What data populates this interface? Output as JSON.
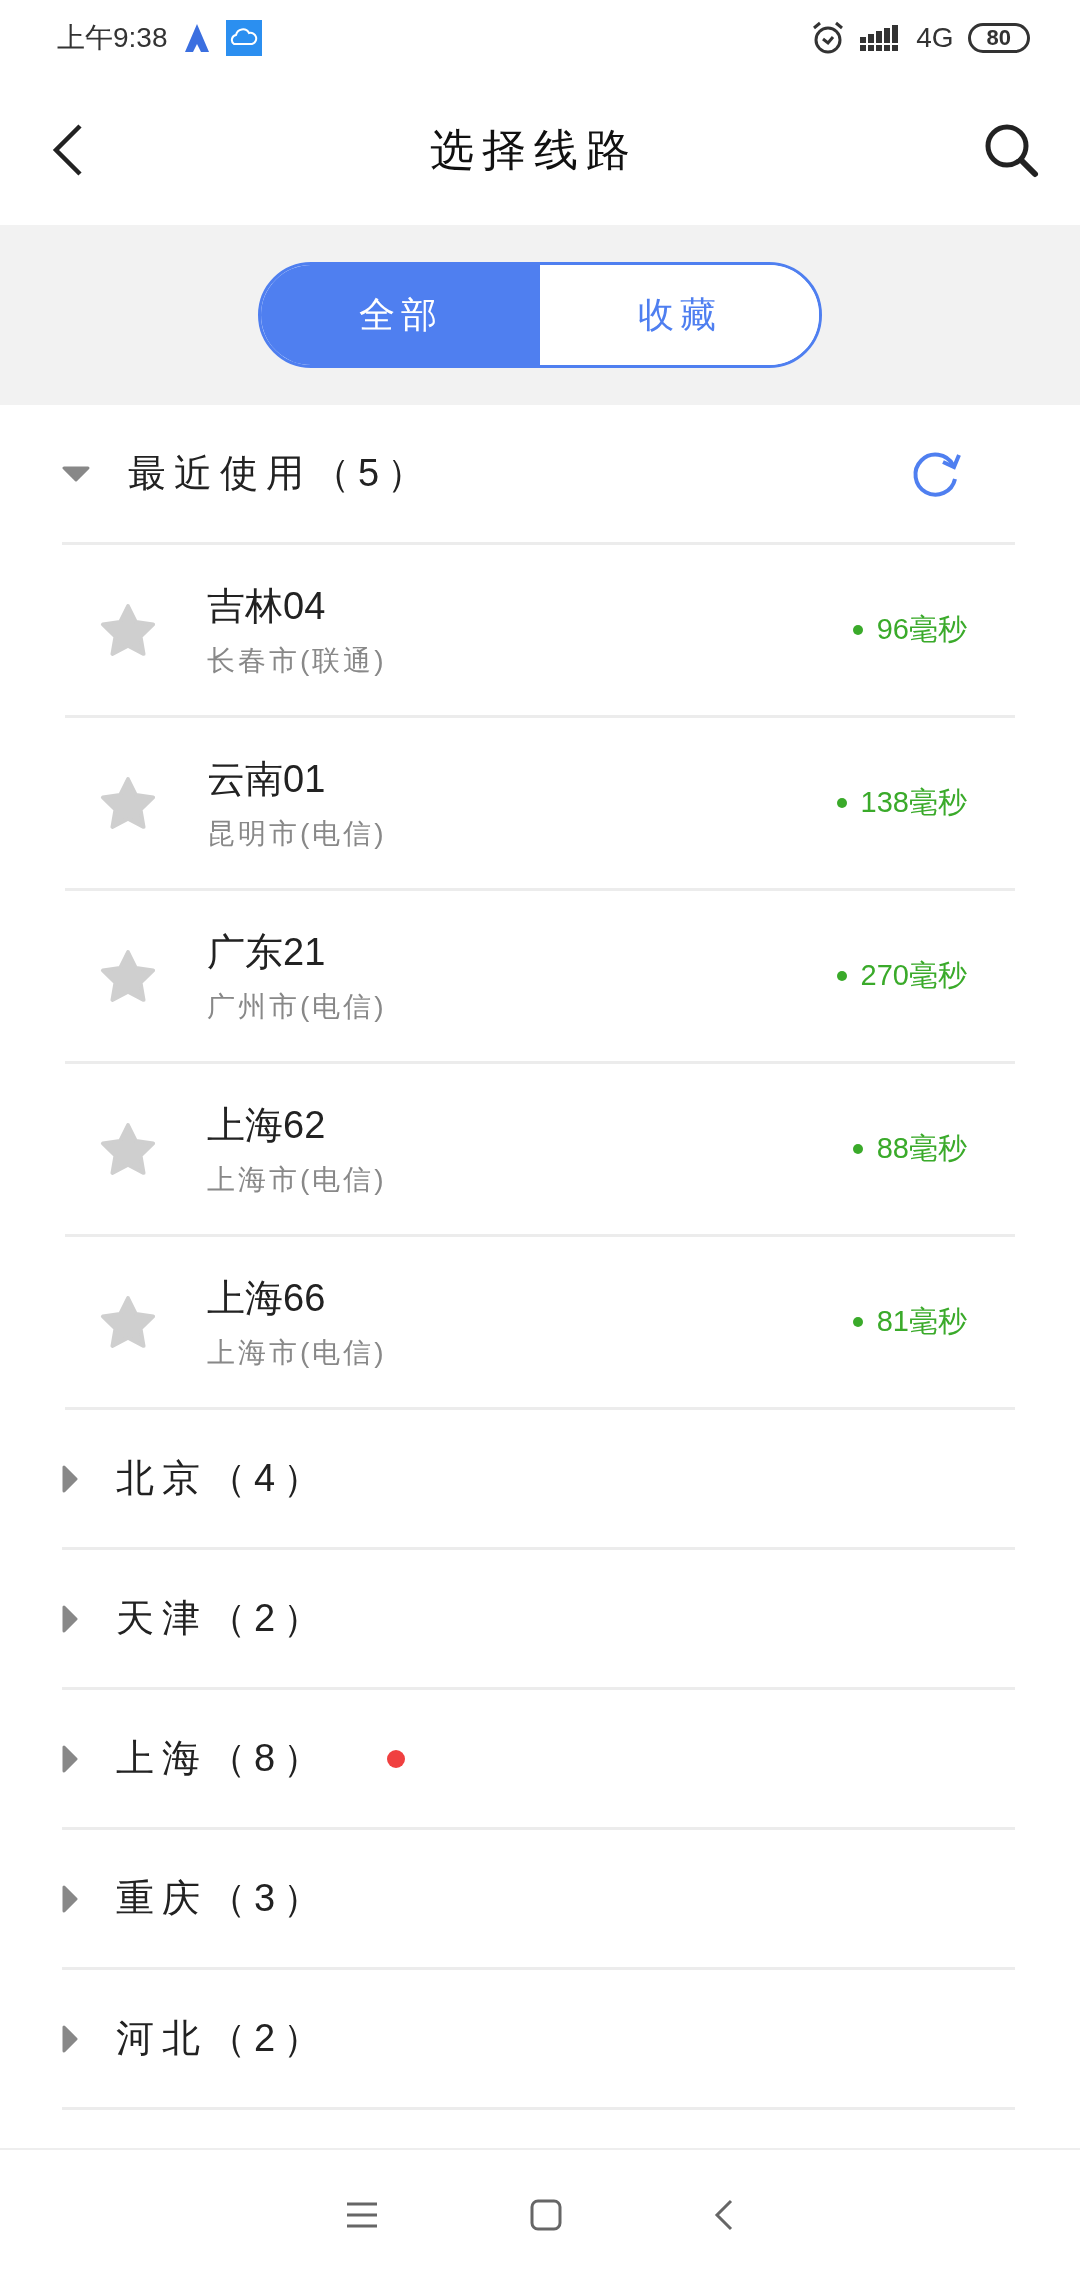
{
  "status_bar": {
    "time": "上午9:38",
    "network": "4G",
    "battery": "80"
  },
  "header": {
    "title": "选择线路"
  },
  "tabs": [
    {
      "label": "全部",
      "selected": true
    },
    {
      "label": "收藏",
      "selected": false
    }
  ],
  "groups": [
    {
      "title": "最近使用（5）",
      "expanded": true,
      "dot": false,
      "refresh": true,
      "servers": [
        {
          "name": "吉林04",
          "location": "长春市(联通)",
          "latency": "96毫秒",
          "favorite": false
        },
        {
          "name": "云南01",
          "location": "昆明市(电信)",
          "latency": "138毫秒",
          "favorite": false
        },
        {
          "name": "广东21",
          "location": "广州市(电信)",
          "latency": "270毫秒",
          "favorite": false
        },
        {
          "name": "上海62",
          "location": "上海市(电信)",
          "latency": "88毫秒",
          "favorite": false
        },
        {
          "name": "上海66",
          "location": "上海市(电信)",
          "latency": "81毫秒",
          "favorite": false
        }
      ]
    },
    {
      "title": "北京（4）",
      "expanded": false,
      "dot": false
    },
    {
      "title": "天津（2）",
      "expanded": false,
      "dot": false
    },
    {
      "title": "上海（8）",
      "expanded": false,
      "dot": true
    },
    {
      "title": "重庆（3）",
      "expanded": false,
      "dot": false
    },
    {
      "title": "河北（2）",
      "expanded": false,
      "dot": false
    }
  ]
}
